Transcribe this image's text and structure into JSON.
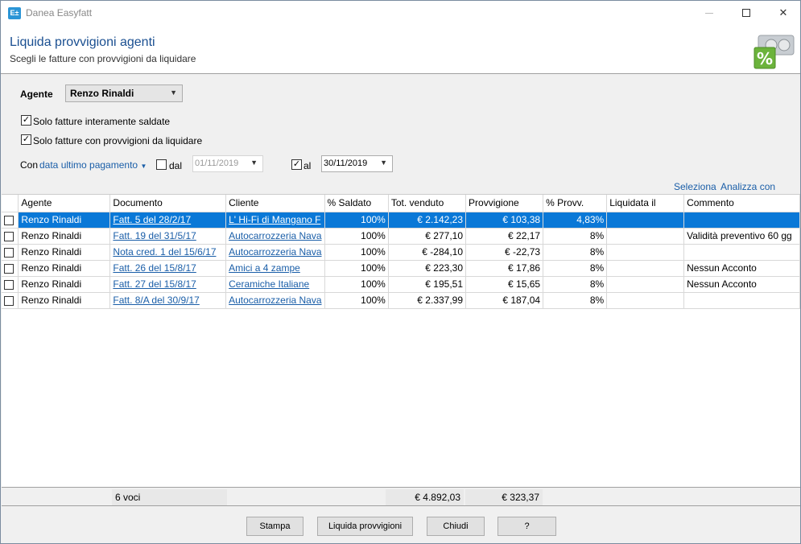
{
  "window": {
    "app_title": "Danea Easyfatt",
    "icon_text": "E±"
  },
  "header": {
    "title": "Liquida provvigioni agenti",
    "subtitle": "Scegli le fatture con provvigioni da liquidare"
  },
  "filters": {
    "agent_label": "Agente",
    "agent_value": "Renzo Rinaldi",
    "only_paid_label": "Solo fatture interamente saldate",
    "only_paid_checked": true,
    "only_commission_label": "Solo fatture con provvigioni da liquidare",
    "only_commission_checked": true,
    "con_label": "Con",
    "date_mode": "data ultimo pagamento",
    "dal_label": "dal",
    "dal_checked": false,
    "dal_value": "01/11/2019",
    "al_label": "al",
    "al_checked": true,
    "al_value": "30/11/2019"
  },
  "links": {
    "seleziona": "Seleziona",
    "analizza": "Analizza con Excel"
  },
  "table": {
    "columns": [
      "Agente",
      "Documento",
      "Cliente",
      "% Saldato",
      "Tot. venduto",
      "Provvigione",
      "% Provv.",
      "Liquidata il",
      "Commento"
    ],
    "rows": [
      {
        "agente": "Renzo Rinaldi",
        "documento": "Fatt. 5 del 28/2/17",
        "cliente": "L' Hi-Fi di Mangano F",
        "saldato": "100%",
        "venduto": "€ 2.142,23",
        "provvigione": "€ 103,38",
        "perc": "4,83%",
        "liquidata": "",
        "commento": ""
      },
      {
        "agente": "Renzo Rinaldi",
        "documento": "Fatt. 19 del 31/5/17",
        "cliente": "Autocarrozzeria Nava",
        "saldato": "100%",
        "venduto": "€ 277,10",
        "provvigione": "€ 22,17",
        "perc": "8%",
        "liquidata": "",
        "commento": "Validità preventivo 60 gg"
      },
      {
        "agente": "Renzo Rinaldi",
        "documento": "Nota cred. 1 del 15/6/17",
        "cliente": "Autocarrozzeria Nava",
        "saldato": "100%",
        "venduto": "€ -284,10",
        "provvigione": "€ -22,73",
        "perc": "8%",
        "liquidata": "",
        "commento": ""
      },
      {
        "agente": "Renzo Rinaldi",
        "documento": "Fatt. 26 del 15/8/17",
        "cliente": "Amici a 4 zampe",
        "saldato": "100%",
        "venduto": "€ 223,30",
        "provvigione": "€ 17,86",
        "perc": "8%",
        "liquidata": "",
        "commento": "Nessun Acconto"
      },
      {
        "agente": "Renzo Rinaldi",
        "documento": "Fatt. 27 del 15/8/17",
        "cliente": "Ceramiche Italiane",
        "saldato": "100%",
        "venduto": "€ 195,51",
        "provvigione": "€ 15,65",
        "perc": "8%",
        "liquidata": "",
        "commento": "Nessun Acconto"
      },
      {
        "agente": "Renzo Rinaldi",
        "documento": "Fatt. 8/A del 30/9/17",
        "cliente": "Autocarrozzeria Nava",
        "saldato": "100%",
        "venduto": "€ 2.337,99",
        "provvigione": "€ 187,04",
        "perc": "8%",
        "liquidata": "",
        "commento": ""
      }
    ]
  },
  "totals": {
    "count": "6 voci",
    "venduto": "€ 4.892,03",
    "provvigione": "€ 323,37"
  },
  "buttons": {
    "stampa": "Stampa",
    "liquida": "Liquida provvigioni",
    "chiudi": "Chiudi",
    "help": "?"
  },
  "colors": {
    "accent": "#0a78d7",
    "title": "#1a4f91",
    "link": "#1a5ea8"
  }
}
